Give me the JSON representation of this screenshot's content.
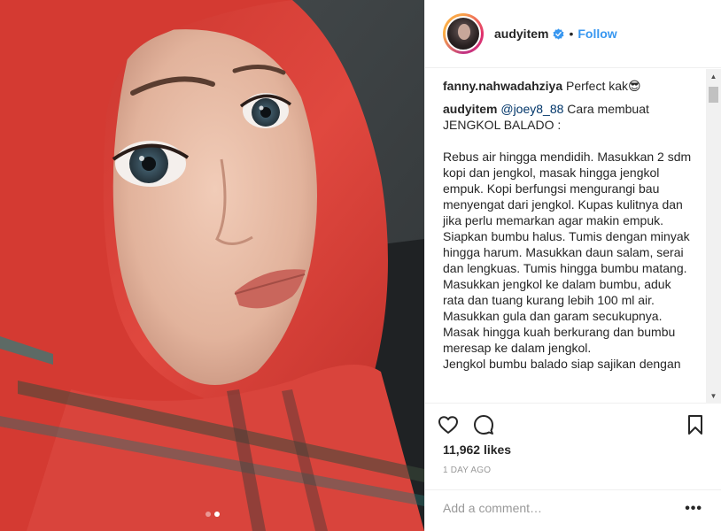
{
  "header": {
    "username": "audyitem",
    "separator": "•",
    "follow_label": "Follow",
    "verified_icon": "verified-badge-icon"
  },
  "comments": [
    {
      "user": "fanny.nahwadahziya",
      "text": "Perfect kak😎"
    }
  ],
  "caption": {
    "user": "audyitem",
    "mention": "@joey8_88",
    "text": " Cara membuat JENGKOL BALADO :\n\nRebus air hingga mendidih. Masukkan 2 sdm kopi dan jengkol, masak hingga jengkol empuk. Kopi berfungsi mengurangi bau menyengat dari jengkol. Kupas kulitnya dan jika perlu memarkan agar makin empuk.\nSiapkan bumbu halus. Tumis dengan minyak hingga harum. Masukkan daun salam, serai dan lengkuas. Tumis hingga bumbu matang.\nMasukkan jengkol ke dalam bumbu, aduk rata dan tuang kurang lebih 100 ml air.\nMasukkan gula dan garam secukupnya.\nMasak hingga kuah berkurang dan bumbu meresap ke dalam jengkol.\nJengkol bumbu balado siap sajikan dengan"
  },
  "stats": {
    "likes": "11,962 likes",
    "time": "1 DAY AGO"
  },
  "comment_box": {
    "placeholder": "Add a comment…"
  },
  "carousel": {
    "count": 2,
    "active": 2
  },
  "colors": {
    "accent": "#3897f0",
    "scarf_red": "#d9443c"
  }
}
